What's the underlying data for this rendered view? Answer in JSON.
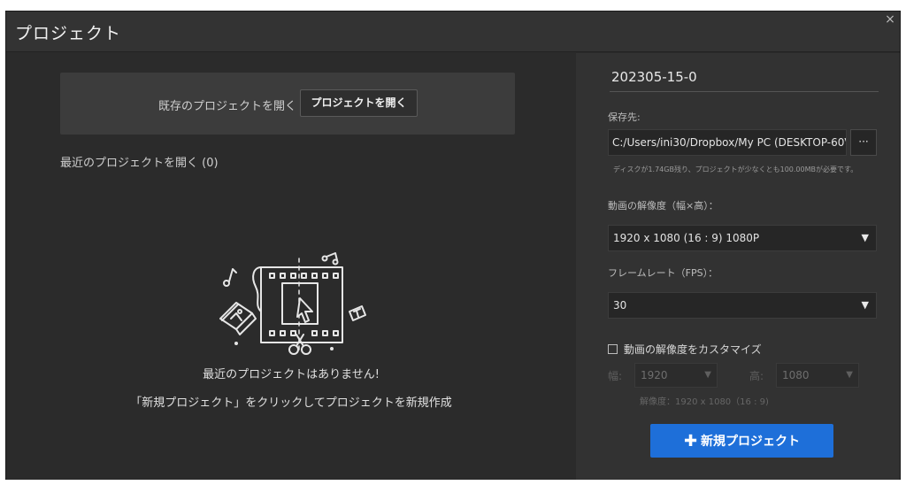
{
  "window": {
    "title": "プロジェクト",
    "close_glyph": "×"
  },
  "left": {
    "open_label": "既存のプロジェクトを開く",
    "open_button": "プロジェクトを開く",
    "recent_title": "最近のプロジェクトを開く (0)",
    "empty_message": "最近のプロジェクトはありません!",
    "empty_hint": "「新規プロジェクト」をクリックしてプロジェクトを新規作成"
  },
  "right": {
    "project_name": "202305-15-0",
    "save_label": "保存先:",
    "save_path": "C:/Users/ini30/Dropbox/My PC (DESKTOP-60V",
    "browse_label": "···",
    "disk_note": "ディスクが1.74GB残り、プロジェクトが少なくとも100.00MBが必要です。",
    "resolution_label": "動画の解像度（幅×高）：",
    "resolution_value": "1920 x 1080   (16 : 9)   1080P",
    "fps_label": "フレームレート（FPS）：",
    "fps_value": "30",
    "custom_label": "動画の解像度をカスタマイズ",
    "width_label": "幅:",
    "width_value": "1920",
    "height_label": "高:",
    "height_value": "1080",
    "resolution_info": "解像度：1920 x 1080（16 : 9)",
    "new_project_button": "新規プロジェクト",
    "new_project_plus": "✚"
  },
  "icons": {
    "dropdown": "▼",
    "close": "close-icon"
  },
  "colors": {
    "accent": "#1e6fd9",
    "window_bg": "#2b2b2b",
    "panel_bg": "#323232"
  }
}
